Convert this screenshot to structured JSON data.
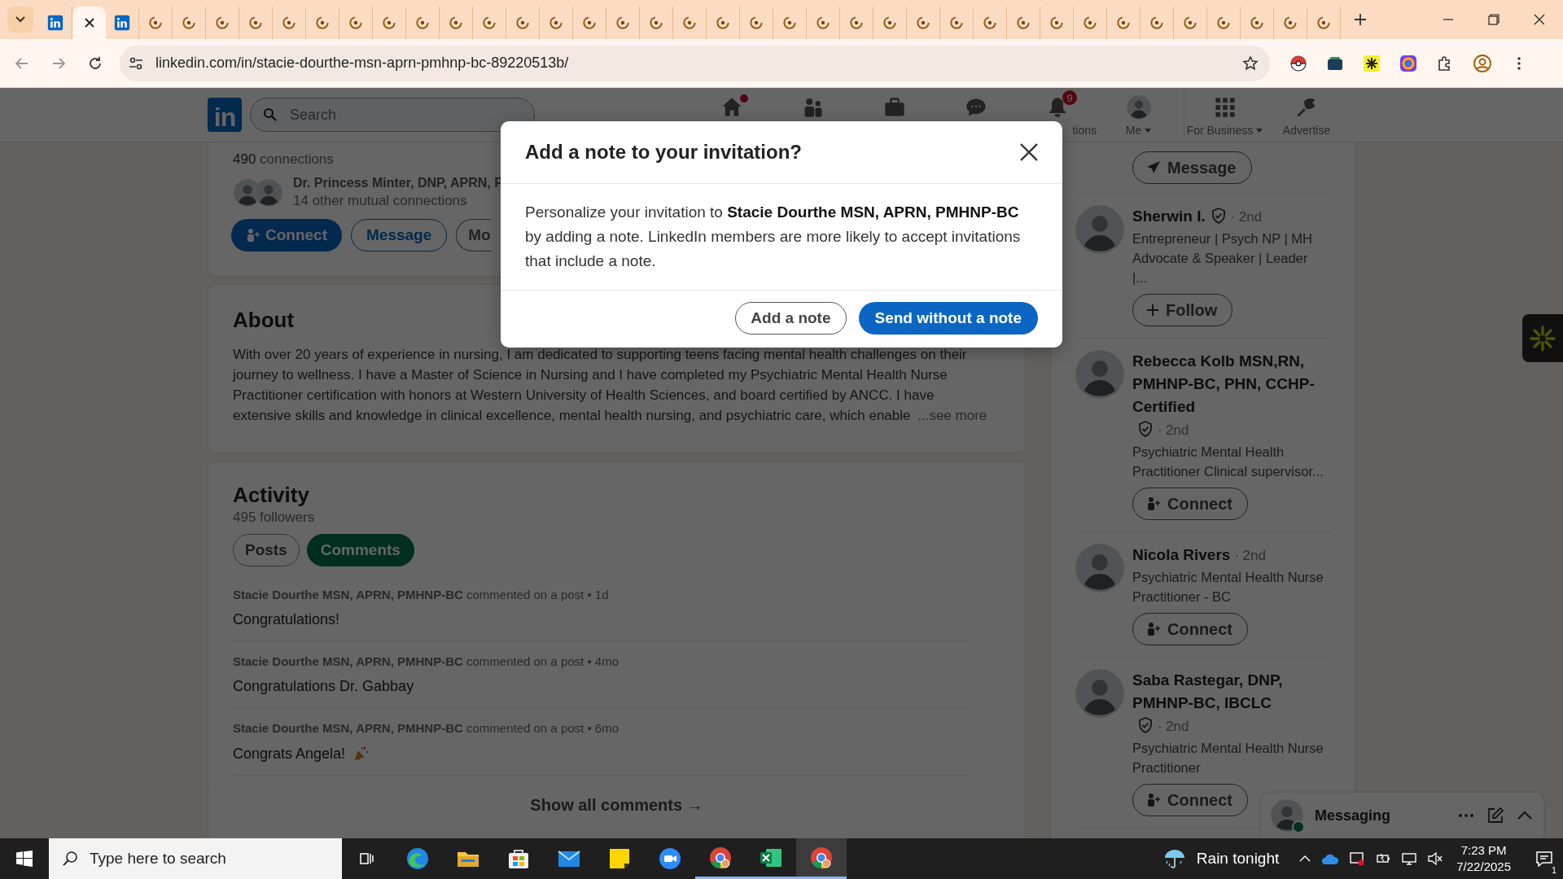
{
  "browser": {
    "tabs": [
      {
        "kind": "linkedin",
        "selected": false
      },
      {
        "selected": true
      },
      {
        "kind": "linkedin",
        "selected": false
      },
      {
        "kind": "loading",
        "selected": false
      },
      {
        "kind": "loading",
        "selected": false
      },
      {
        "kind": "loading",
        "selected": false
      },
      {
        "kind": "loading",
        "selected": false
      },
      {
        "kind": "loading",
        "selected": false
      },
      {
        "kind": "loading",
        "selected": false
      },
      {
        "kind": "loading",
        "selected": false
      },
      {
        "kind": "loading",
        "selected": false
      },
      {
        "kind": "loading",
        "selected": false
      },
      {
        "kind": "loading",
        "selected": false
      },
      {
        "kind": "loading",
        "selected": false
      },
      {
        "kind": "loading",
        "selected": false
      },
      {
        "kind": "loading",
        "selected": false
      },
      {
        "kind": "loading",
        "selected": false
      },
      {
        "kind": "loading",
        "selected": false
      },
      {
        "kind": "loading",
        "selected": false
      },
      {
        "kind": "loading",
        "selected": false
      },
      {
        "kind": "loading",
        "selected": false
      },
      {
        "kind": "loading",
        "selected": false
      },
      {
        "kind": "loading",
        "selected": false
      },
      {
        "kind": "loading",
        "selected": false
      },
      {
        "kind": "loading",
        "selected": false
      },
      {
        "kind": "loading",
        "selected": false
      },
      {
        "kind": "loading",
        "selected": false
      },
      {
        "kind": "loading",
        "selected": false
      },
      {
        "kind": "loading",
        "selected": false
      },
      {
        "kind": "loading",
        "selected": false
      },
      {
        "kind": "loading",
        "selected": false
      },
      {
        "kind": "loading",
        "selected": false
      },
      {
        "kind": "loading",
        "selected": false
      },
      {
        "kind": "loading",
        "selected": false
      },
      {
        "kind": "loading",
        "selected": false
      },
      {
        "kind": "loading",
        "selected": false
      },
      {
        "kind": "loading",
        "selected": false
      },
      {
        "kind": "loading",
        "selected": false
      },
      {
        "kind": "loading",
        "selected": false
      }
    ],
    "url": "linkedin.com/in/stacie-dourthe-msn-aprn-pmhnp-bc-89220513b/"
  },
  "nav": {
    "logo": "in",
    "search": {
      "placeholder": "Search"
    },
    "items": [
      {
        "kind": "home",
        "dot": true
      },
      {
        "kind": "network"
      },
      {
        "kind": "jobs"
      },
      {
        "kind": "messaging"
      },
      {
        "kind": "notifications",
        "badge": "9",
        "label": "tions"
      },
      {
        "kind": "me",
        "label": "Me"
      },
      {
        "kind": "business",
        "label": "For Business"
      },
      {
        "kind": "advertise",
        "label": "Advertise"
      }
    ]
  },
  "profile_card": {
    "connections": "**490** connections",
    "mutual": "Dr. Princess Minter, DNP, APRN, P",
    "mutual_more": "14 other mutual connections",
    "buttons": [
      {
        "label": "Connect",
        "kind": "primary"
      },
      {
        "label": "Message",
        "kind": "secondary"
      },
      {
        "label": "Mo",
        "kind": "cut"
      }
    ]
  },
  "about": {
    "title": "About",
    "text": "With over 20 years of experience in nursing, I am dedicated to supporting teens facing mental health challenges on their journey to wellness. I have a Master of Science in Nursing and I have completed my Psychiatric Mental Health Nurse Practitioner certification with honors at Western University of Health Sciences, and board certified by ANCC. I have extensive skills and knowledge in clinical excellence, mental health nursing, and psychiatric care, which enable",
    "more": "...see more"
  },
  "activity": {
    "title": "Activity",
    "followers": "495 followers",
    "filters": [
      {
        "label": "Posts",
        "selected": false
      },
      {
        "label": "Comments",
        "selected": true
      }
    ],
    "comments": [
      {
        "author": "Stacie Dourthe MSN, APRN, PMHNP-BC",
        "meta": "commented on a post • 1d",
        "text": "Congratulations!",
        "emoji": false
      },
      {
        "author": "Stacie Dourthe MSN, APRN, PMHNP-BC",
        "meta": "commented on a post • 4mo",
        "text": "Congratulations Dr. Gabbay",
        "emoji": false
      },
      {
        "author": "Stacie Dourthe MSN, APRN, PMHNP-BC",
        "meta": "commented on a post • 6mo",
        "text": "Congrats Angela!",
        "emoji": true
      }
    ],
    "show_all": "Show all comments →"
  },
  "sidebar": {
    "top_button": "Message",
    "people": [
      {
        "name": "Sherwin I.",
        "verified": true,
        "degree": "· 2nd",
        "headline": "Entrepreneur | Psych NP | MH Advocate & Speaker | Leader |...",
        "action": {
          "kind": "follow",
          "label": "Follow"
        }
      },
      {
        "name": "Rebecca Kolb MSN,RN, PMHNP-BC, PHN, CCHP-Certified",
        "verified": true,
        "degree": "· 2nd",
        "headline": "Psychiatric Mental Health Practitioner Clinical supervisor...",
        "action": {
          "kind": "connect",
          "label": "Connect"
        }
      },
      {
        "name": "Nicola Rivers",
        "verified": false,
        "degree": "· 2nd",
        "headline": "Psychiatric Mental Health Nurse Practitioner - BC",
        "action": {
          "kind": "connect",
          "label": "Connect"
        }
      },
      {
        "name": "Saba Rastegar, DNP, PMHNP-BC, IBCLC",
        "verified": true,
        "degree": "· 2nd",
        "headline": "Psychiatric Mental Health Nurse Practitioner",
        "action": {
          "kind": "connect",
          "label": "Connect"
        }
      }
    ]
  },
  "messaging": {
    "title": "Messaging",
    "online": true
  },
  "modal": {
    "open": true,
    "title": "Add a note to your invitation?",
    "body": "Personalize your invitation to **Stacie Dourthe MSN, APRN, PMHNP-BC** by adding a note. LinkedIn members are more likely to accept invitations that include a note.",
    "buttons": [
      {
        "label": "Add a note",
        "kind": "secondary"
      },
      {
        "label": "Send without a note",
        "kind": "primary"
      }
    ]
  },
  "taskbar": {
    "search": {
      "placeholder": "Type here to search"
    },
    "apps": [
      {
        "kind": "edge",
        "running": false,
        "selected": false
      },
      {
        "kind": "explorer",
        "running": false,
        "selected": false
      },
      {
        "kind": "store",
        "running": false,
        "selected": false
      },
      {
        "kind": "mail",
        "running": false,
        "selected": false
      },
      {
        "kind": "notes",
        "running": false,
        "selected": false
      },
      {
        "kind": "zoom",
        "running": false,
        "selected": false
      },
      {
        "kind": "chrome",
        "running": true,
        "selected": false
      },
      {
        "kind": "excel",
        "running": true,
        "selected": false
      },
      {
        "kind": "chrome",
        "running": true,
        "selected": true
      }
    ],
    "weather": "Rain tonight",
    "time": "7:23 PM",
    "date": "7/22/2025",
    "notifications": "1"
  }
}
